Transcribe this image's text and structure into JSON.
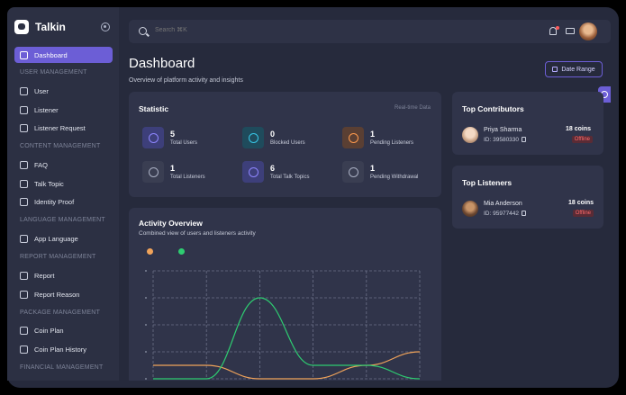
{
  "app": {
    "name": "Talkin"
  },
  "sidebar": {
    "items": [
      {
        "label": "Dashboard",
        "icon": "home-icon",
        "active": true
      },
      {
        "section": "USER MANAGEMENT"
      },
      {
        "label": "User",
        "icon": "user-icon"
      },
      {
        "label": "Listener",
        "icon": "listener-icon"
      },
      {
        "label": "Listener Request",
        "icon": "request-icon"
      },
      {
        "section": "CONTENT MANAGEMENT"
      },
      {
        "label": "FAQ",
        "icon": "faq-icon"
      },
      {
        "label": "Talk Topic",
        "icon": "chat-icon"
      },
      {
        "label": "Identity Proof",
        "icon": "id-card-icon"
      },
      {
        "section": "LANGUAGE MANAGEMENT"
      },
      {
        "label": "App Language",
        "icon": "language-icon"
      },
      {
        "section": "REPORT MANAGEMENT"
      },
      {
        "label": "Report",
        "icon": "report-icon"
      },
      {
        "label": "Report Reason",
        "icon": "list-icon"
      },
      {
        "section": "PACKAGE MANAGEMENT"
      },
      {
        "label": "Coin Plan",
        "icon": "coin-icon"
      },
      {
        "label": "Coin Plan History",
        "icon": "history-icon"
      },
      {
        "section": "FINANCIAL MANAGEMENT"
      }
    ]
  },
  "topbar": {
    "search_placeholder": "Search ⌘K"
  },
  "header": {
    "title": "Dashboard",
    "subtitle": "Overview of platform activity and insights",
    "date_range_label": "Date Range"
  },
  "statistic": {
    "title": "Statistic",
    "realtime_label": "Real-time Data",
    "stats": [
      {
        "value": "5",
        "label": "Total Users",
        "icon": "users-icon",
        "color": "#3d3f7a",
        "icon_color": "#8f86ff"
      },
      {
        "value": "0",
        "label": "Blocked Users",
        "icon": "blocked-icon",
        "color": "#1f4b5c",
        "icon_color": "#38c7e8"
      },
      {
        "value": "1",
        "label": "Pending Listeners",
        "icon": "warning-icon",
        "color": "#5a3f33",
        "icon_color": "#ff9a4d"
      },
      {
        "value": "1",
        "label": "Total Listeners",
        "icon": "listener-icon",
        "color": "#3a3e52",
        "icon_color": "#aab0c4"
      },
      {
        "value": "6",
        "label": "Total Talk Topics",
        "icon": "chat-icon",
        "color": "#3d3f7a",
        "icon_color": "#8f86ff"
      },
      {
        "value": "1",
        "label": "Pending Withdrawal",
        "icon": "clock-icon",
        "color": "#3a3e52",
        "icon_color": "#aab0c4"
      }
    ]
  },
  "activity": {
    "title": "Activity Overview",
    "subtitle": "Combined view of users and listeners activity",
    "legend_colors": [
      "#f0a35a",
      "#2ecc71"
    ]
  },
  "chart_data": {
    "type": "line",
    "x": [
      0,
      1,
      2,
      3,
      4,
      5
    ],
    "series": [
      {
        "values": [
          0.5,
          0.5,
          0.0,
          0.0,
          0.5,
          1.0
        ],
        "color": "#f0a35a"
      },
      {
        "values": [
          0.0,
          0.0,
          3.0,
          0.5,
          0.5,
          0.0
        ],
        "color": "#2ecc71"
      }
    ],
    "ylim": [
      0,
      4
    ],
    "grid": true
  },
  "top_contributors": {
    "title": "Top Contributors",
    "people": [
      {
        "name": "Priya Sharma",
        "id": "ID: 39580330",
        "coins": "18 coins",
        "status": "Offline"
      }
    ]
  },
  "top_listeners": {
    "title": "Top Listeners",
    "people": [
      {
        "name": "Mia Anderson",
        "id": "ID: 95977442",
        "coins": "18 coins",
        "status": "Offline"
      }
    ]
  }
}
